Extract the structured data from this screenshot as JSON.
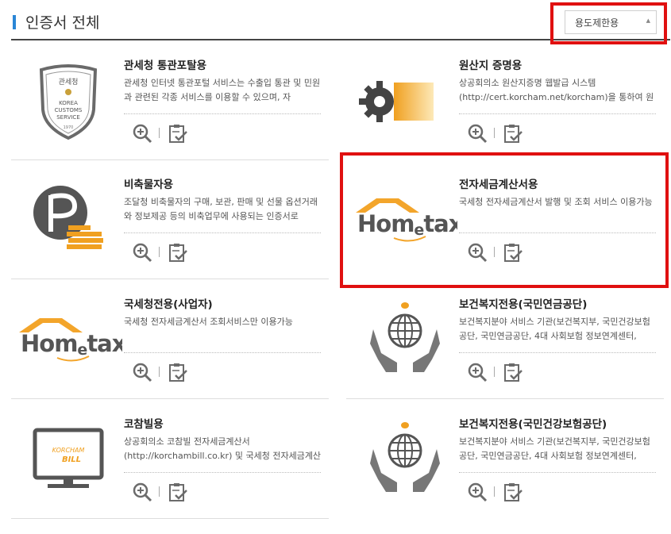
{
  "page": {
    "title": "인증서 전체",
    "filter_select": {
      "value": "용도제한용"
    }
  },
  "certificates": [
    {
      "name": "관세청 통관포탈용",
      "desc": "관세청 인터넷 통관포털 서비스는 수출입 통관 및 민원과 관련된 각종 서비스를 이용할 수 있으며, 자",
      "logo": "customs-emblem",
      "emblem_top": "관세청",
      "emblem_lines": [
        "KOREA",
        "CUSTOMS",
        "SERVICE"
      ],
      "emblem_year": "1970"
    },
    {
      "name": "원산지 증명용",
      "desc": "상공회의소 원산지증명 웹발급 시스템 (http://cert.korcham.net/korcham)을 통하여 원산지증",
      "logo": "gear-logo"
    },
    {
      "name": "비축물자용",
      "desc": "조달청 비축물자의 구매, 보관, 판매 및 선물 옵션거래와 정보제공 등의 비축업무에 사용되는 인증서로",
      "logo": "pps-coin-logo"
    },
    {
      "name": "전자세금계산서용",
      "desc": "국세청 전자세금계산서 발행 및 조회 서비스 이용가능",
      "logo": "hometax-logo"
    },
    {
      "name": "국세청전용(사업자)",
      "desc": "국세청 전자세금계산서 조회서비스만 이용가능",
      "logo": "hometax-logo"
    },
    {
      "name": "보건복지전용(국민연금공단)",
      "desc": "보건복지분야 서비스 기관(보건복지부, 국민건강보험공단, 국민연금공단, 4대 사회보험 정보연계센터,",
      "logo": "globe-hands-logo"
    },
    {
      "name": "코참빌용",
      "desc": "상공회의소 코참빌 전자세금계산서 (http://korchambill.co.kr) 및 국세청 전자세금계산서",
      "logo": "korchambill-monitor-logo",
      "logo_text_1": "KORCHAM",
      "logo_text_2": "BILL"
    },
    {
      "name": "보건복지전용(국민건강보험공단)",
      "desc": "보건복지분야 서비스 기관(보건복지부, 국민건강보험공단, 국민연금공단, 4대 사회보험 정보연계센터,",
      "logo": "globe-hands-logo"
    }
  ],
  "hometax_logo": {
    "part1": "Hom",
    "part2": "e",
    "part3": "tax."
  },
  "icons": {
    "zoom": "zoom-in-icon",
    "select": "clipboard-check-icon"
  },
  "colors": {
    "accent": "#2a86d6",
    "highlight": "#e01010",
    "hometax_orange": "#f3a52b",
    "icon_gray": "#6b6b6b"
  }
}
